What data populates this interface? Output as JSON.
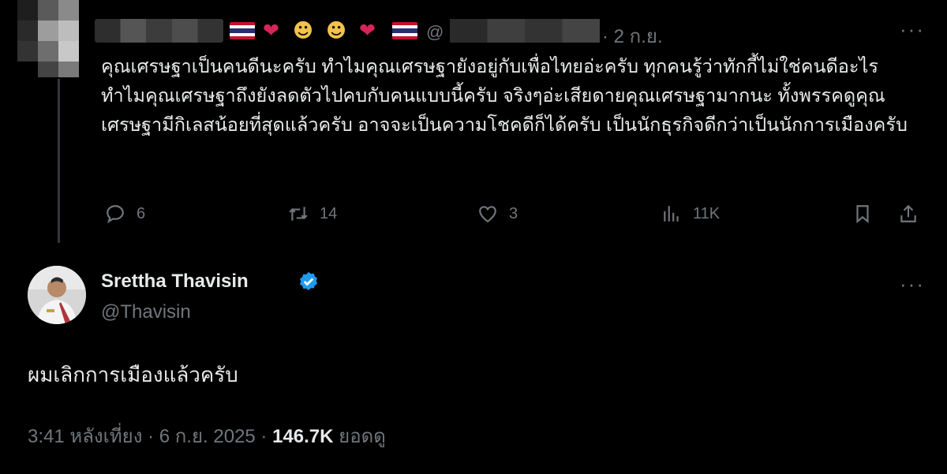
{
  "reply": {
    "at_symbol": "@",
    "date": "· 2 ก.ย.",
    "more": "···",
    "text": "คุณเศรษฐาเป็นคนดีนะครับ ทำไมคุณเศรษฐายังอยู่กับเพื่อไทยอ่ะครับ ทุกคนรู้ว่าทักกี้ไม่ใช่คนดีอะไรทำไมคุณเศรษฐาถึงยังลดตัวไปคบกับคนแบบนี้ครับ จริงๆอ่ะเสียดายคุณเศรษฐามากนะ ทั้งพรรคดูคุณเศรษฐามีกิเลสน้อยที่สุดแล้วครับ อาจจะเป็นความโชคดีก็ได้ครับ เป็นนักธุรกิจดีกว่าเป็นนักการเมืองครับ",
    "reply_count": "6",
    "retweet_count": "14",
    "like_count": "3",
    "view_count": "11K",
    "icons": [
      "reply-icon",
      "retweet-icon",
      "like-icon",
      "views-icon",
      "bookmark-icon",
      "share-icon"
    ]
  },
  "main": {
    "display_name": "Srettha Thavisin",
    "handle": "@Thavisin",
    "more": "···",
    "text": "ผมเลิกการเมืองแล้วครับ",
    "time": "3:41 หลังเที่ยง · 6 ก.ย. 2025 · ",
    "views": "146.7K",
    "views_label": " ยอดดู"
  },
  "colors": {
    "background": "#000000",
    "text": "#e7e9ea",
    "muted": "#71767b",
    "verified": "#1d9bf0"
  }
}
